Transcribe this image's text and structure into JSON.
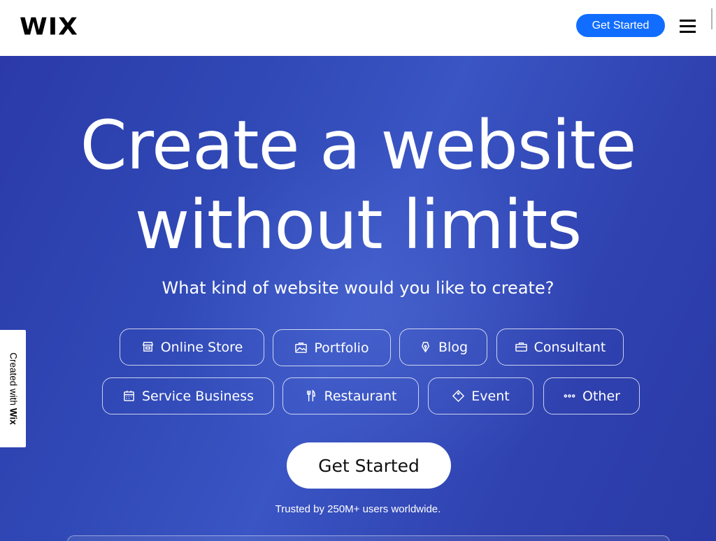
{
  "header": {
    "logo": "WIX",
    "cta_label": "Get Started"
  },
  "hero": {
    "headline_line1": "Create a website",
    "headline_line2": "without limits",
    "subheadline": "What kind of website would you like to create?",
    "chips": [
      {
        "label": "Online Store",
        "icon": "store-icon"
      },
      {
        "label": "Portfolio",
        "icon": "image-icon"
      },
      {
        "label": "Blog",
        "icon": "pen-nib-icon"
      },
      {
        "label": "Consultant",
        "icon": "briefcase-icon"
      },
      {
        "label": "Service Business",
        "icon": "calendar-icon"
      },
      {
        "label": "Restaurant",
        "icon": "utensils-icon"
      },
      {
        "label": "Event",
        "icon": "ticket-icon"
      },
      {
        "label": "Other",
        "icon": "more-icon"
      }
    ],
    "cta_label": "Get Started",
    "trust_text": "Trusted by 250M+ users worldwide."
  },
  "wix_badge": {
    "text_prefix": "Created with",
    "text_brand": "Wix"
  },
  "colors": {
    "header_cta": "#116dff",
    "hero_bg": "#3049b6",
    "text_light": "#ffffff"
  }
}
